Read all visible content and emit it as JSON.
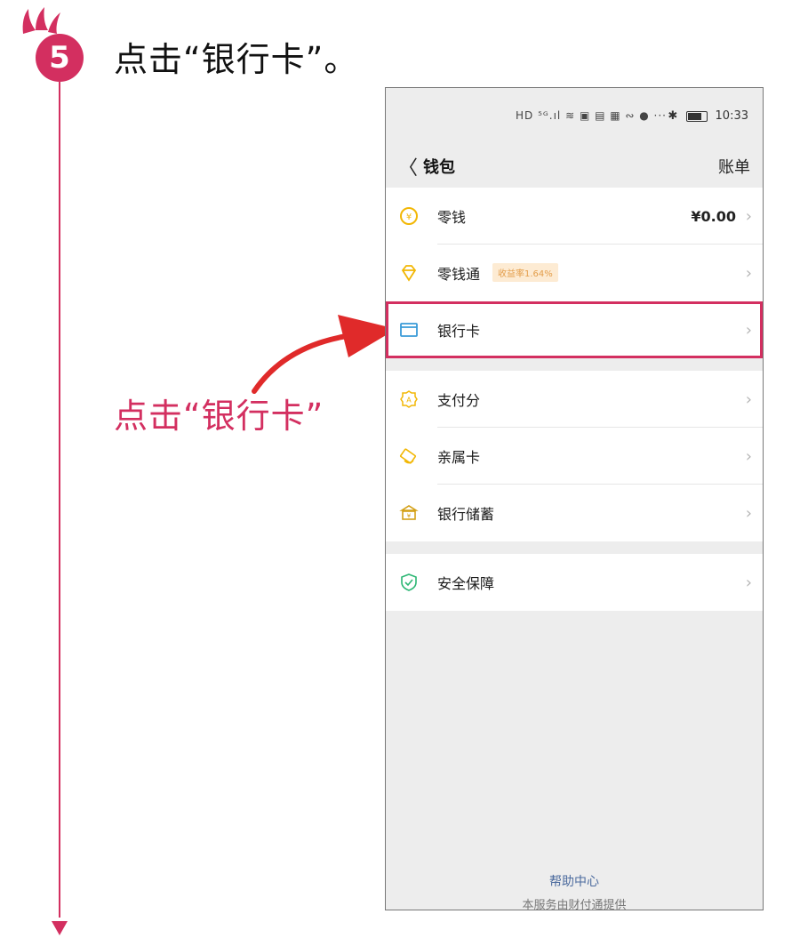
{
  "step": {
    "number": "5",
    "title": "点击“银行卡”。"
  },
  "callout": {
    "text": "点击“银行卡”"
  },
  "colors": {
    "accent": "#d32f60",
    "bg": "#ededed",
    "link": "#4c6b9e"
  },
  "phone": {
    "status": {
      "icons": "HD ⁵ᴳ.ıl ≋ ▣ ▤ ▦ ∾ ● ···",
      "bluetooth": "✱",
      "time": "10:33"
    },
    "nav": {
      "back": "〈",
      "title": "钱包",
      "right": "账单"
    },
    "groups": [
      {
        "items": [
          {
            "label": "零钱",
            "value": "¥0.00",
            "icon": "yuan-coin-icon"
          },
          {
            "label": "零钱通",
            "badge": "收益率1.64%",
            "icon": "diamond-icon"
          },
          {
            "label": "银行卡",
            "icon": "card-icon",
            "highlighted": true
          }
        ]
      },
      {
        "items": [
          {
            "label": "支付分",
            "icon": "score-badge-icon"
          },
          {
            "label": "亲属卡",
            "icon": "family-card-icon"
          },
          {
            "label": "银行储蓄",
            "icon": "bank-icon"
          }
        ]
      },
      {
        "items": [
          {
            "label": "安全保障",
            "icon": "shield-icon"
          }
        ]
      }
    ],
    "chevron": "›",
    "footer": {
      "help": "帮助中心",
      "provider": "本服务由财付通提供"
    }
  }
}
